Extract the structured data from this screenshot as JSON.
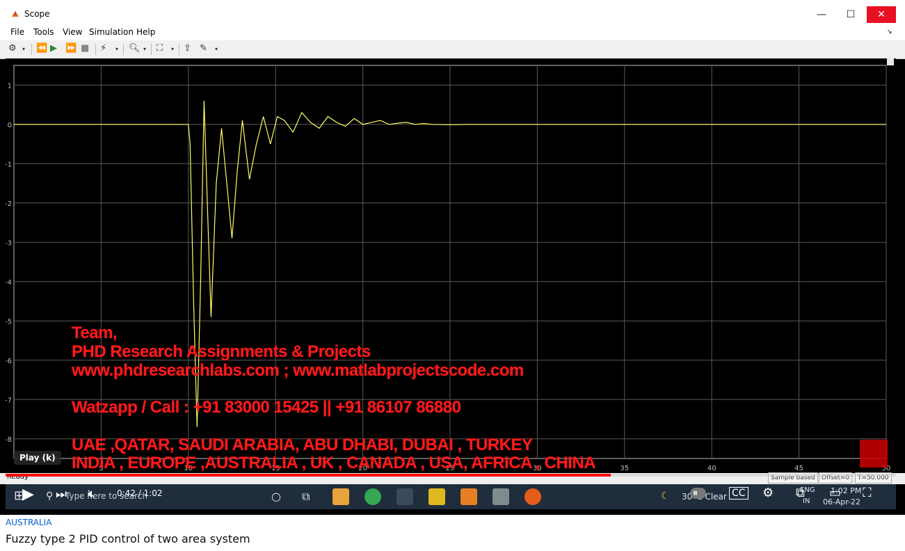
{
  "window": {
    "title": "Scope",
    "minimize": "—",
    "maximize": "☐",
    "close": "✕"
  },
  "menu": [
    "File",
    "Tools",
    "View",
    "Simulation",
    "Help"
  ],
  "status": {
    "ready": "Ready",
    "sample_mode": "Sample based",
    "offset": "Offset=0",
    "time": "T=50.000"
  },
  "chart_data": {
    "type": "line",
    "title": "",
    "xlabel": "",
    "ylabel": "",
    "xlim": [
      0,
      50
    ],
    "ylim": [
      -8.5,
      1.5
    ],
    "x_ticks": [
      5,
      10,
      15,
      20,
      25,
      30,
      35,
      40,
      45,
      50
    ],
    "x_tick_labels": [
      "5",
      "10",
      "15",
      "20",
      "25",
      "30",
      "35",
      "40",
      "45",
      "50"
    ],
    "y_ticks": [
      1,
      0,
      -1,
      -2,
      -3,
      -4,
      -5,
      -6,
      -7,
      -8
    ],
    "y_tick_labels": [
      "1",
      "0",
      "-1",
      "-2",
      "-3",
      "-4",
      "-5",
      "-6",
      "-7",
      "-8"
    ],
    "grid": true,
    "series": [
      {
        "color": "#ffff66",
        "x": [
          0,
          10,
          10.1,
          10.3,
          10.5,
          10.7,
          10.9,
          11.1,
          11.3,
          11.6,
          11.9,
          12.2,
          12.5,
          12.8,
          13.1,
          13.5,
          13.9,
          14.3,
          14.7,
          15.1,
          15.5,
          16,
          16.5,
          17,
          17.5,
          18,
          18.5,
          19,
          19.5,
          20,
          20.5,
          21,
          21.5,
          22,
          22.5,
          23,
          23.5,
          24,
          25,
          26,
          50
        ],
        "y": [
          0,
          0,
          -0.5,
          -4.5,
          -7.7,
          -4.0,
          0.6,
          -2.2,
          -4.9,
          -1.5,
          -0.1,
          -1.5,
          -2.9,
          -1.2,
          0.1,
          -1.4,
          -0.5,
          0.2,
          -0.5,
          0.2,
          0.1,
          -0.2,
          0.3,
          0.05,
          -0.1,
          0.2,
          0.05,
          -0.05,
          0.15,
          0.0,
          0.05,
          0.1,
          0.0,
          0.03,
          0.05,
          0.0,
          0.02,
          0.0,
          -0.01,
          0.0,
          0.0
        ]
      }
    ]
  },
  "overlay": {
    "line1": "Team,",
    "line2": "PHD Research Assignments & Projects",
    "line3": "www.phdresearchlabs.com ; www.matlabprojectscode.com",
    "line4": "Watzapp / Call : +91 83000 15425 || +91 86107 86880",
    "line5": "UAE ,QATAR, SAUDI ARABIA, ABU DHABI, DUBAI , TURKEY",
    "line6": "INDIA , EUROPE ,AUSTRALIA , UK , CANADA , USA, AFRICA , CHINA"
  },
  "player": {
    "tooltip": "Play (k)",
    "time": "0:42 / 1:02",
    "progress_fraction": 0.68
  },
  "taskbar": {
    "search_placeholder": "Type here to search",
    "weather": "30°C  Clear",
    "lang1": "ENG",
    "lang2": "IN",
    "clock_time": "1:02 PM",
    "clock_date": "06-Apr-22"
  },
  "video": {
    "channel": "AUSTRALIA",
    "title": "Fuzzy type 2 PID control of two area system"
  }
}
